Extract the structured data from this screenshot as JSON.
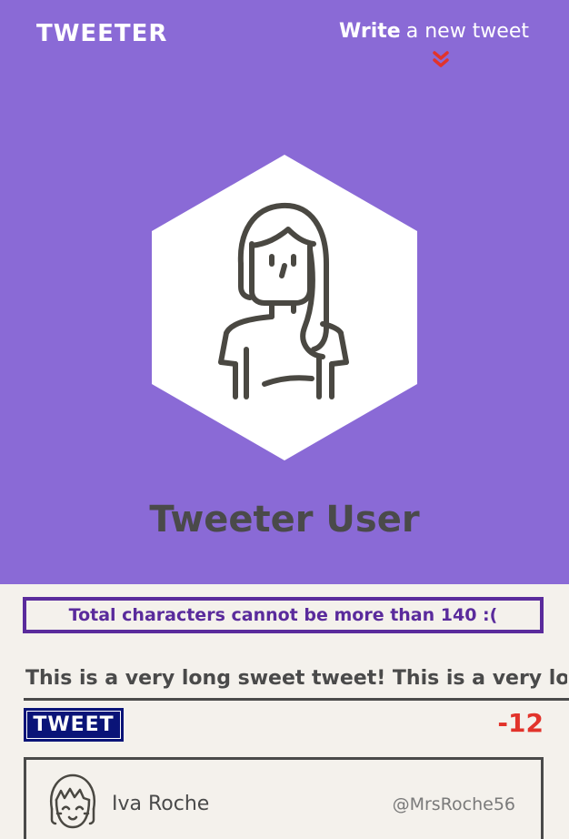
{
  "header": {
    "logo": "TWEETER",
    "write_bold": "Write",
    "write_rest": "a new tweet",
    "bg_color": "#8a6ad6"
  },
  "profile": {
    "name": "Tweeter User",
    "avatar_icon": "woman-avatar-icon"
  },
  "compose": {
    "error_message": "Total characters cannot be more than 140 :(",
    "value": "This is a very long sweet tweet! This is a very long sweet tweet!",
    "tweet_button": "TWEET",
    "counter": "-12",
    "counter_color": "#e2332b"
  },
  "tweets": [
    {
      "name": "Iva Roche",
      "handle": "@MrsRoche56",
      "avatar_icon": "girl-avatar-icon"
    }
  ]
}
